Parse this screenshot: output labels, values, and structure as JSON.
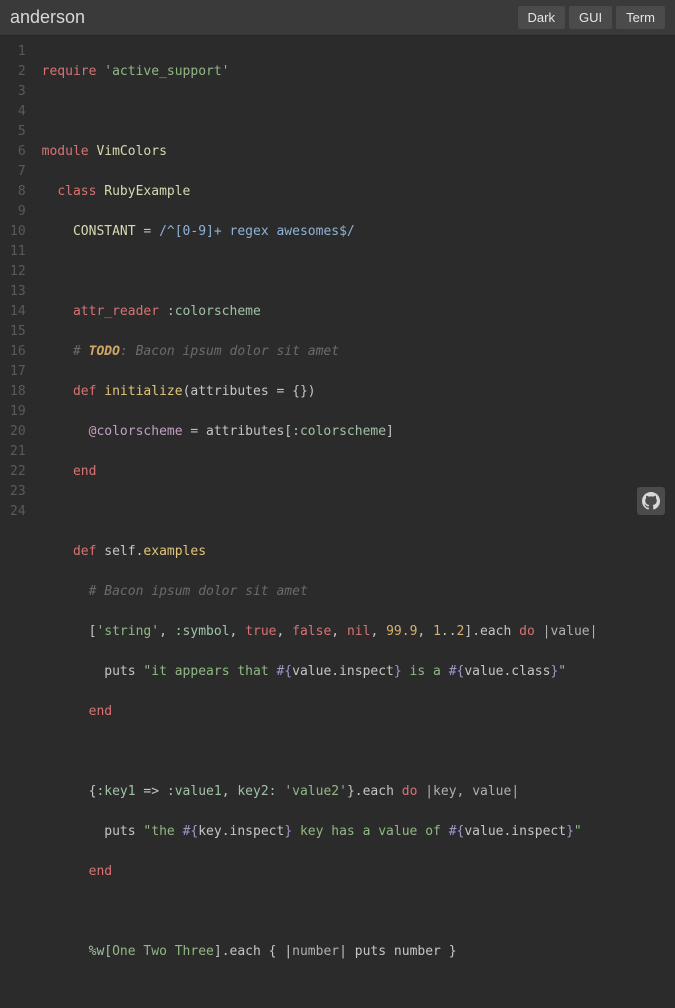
{
  "header": {
    "title": "anderson",
    "buttons": {
      "dark": "Dark",
      "gui": "GUI",
      "term": "Term"
    }
  },
  "code": {
    "l1": {
      "require": "require",
      "str": "'active_support'"
    },
    "l3": {
      "module": "module",
      "name": "VimColors"
    },
    "l4": {
      "class": "class",
      "name": "RubyExample"
    },
    "l5": {
      "const": "CONSTANT",
      "eq": "=",
      "regex": "/^[0-9]+ regex awesomes$/"
    },
    "l7": {
      "attr": "attr_reader",
      "sym": ":colorscheme"
    },
    "l8": {
      "hash": "#",
      "todo": "TODO",
      "rest": ": Bacon ipsum dolor sit amet"
    },
    "l9": {
      "def": "def",
      "name": "initialize",
      "args": "(attributes = {})"
    },
    "l10": {
      "ivar": "@colorscheme",
      "eq": "=",
      "rhs1": "attributes[",
      "sym": ":colorscheme",
      "rhs2": "]"
    },
    "l11": {
      "end": "end"
    },
    "l13": {
      "def": "def",
      "self": "self",
      "dot": ".",
      "name": "examples"
    },
    "l14": {
      "cmt": "# Bacon ipsum dolor sit amet"
    },
    "l15": {
      "lb": "[",
      "str": "'string'",
      "c1": ", ",
      "sym": ":symbol",
      "c2": ", ",
      "true": "true",
      "c3": ", ",
      "false": "false",
      "c4": ", ",
      "nil": "nil",
      "c5": ", ",
      "n1": "99.9",
      "c6": ", ",
      "r1": "1",
      "dd": "..",
      "r2": "2",
      "rb": "].each ",
      "do": "do",
      "blk": " |value|"
    },
    "l16": {
      "puts": "puts ",
      "q1": "\"it appears that ",
      "io": "#{",
      "v1": "value.inspect",
      "ic": "}",
      "mid": " is a ",
      "io2": "#{",
      "v2": "value.class",
      "ic2": "}",
      "q2": "\""
    },
    "l17": {
      "end": "end"
    },
    "l19": {
      "lb": "{",
      "sym1": ":key1",
      "ar": " => ",
      "sym2": ":value1",
      "c1": ", ",
      "k2": "key2:",
      "sp": " ",
      "str2": "'value2'",
      "rb": "}.each ",
      "do": "do",
      "blk": " |key, value|"
    },
    "l20": {
      "puts": "puts ",
      "q1": "\"the ",
      "io": "#{",
      "v1": "key.inspect",
      "ic": "}",
      "mid": " key has a value of ",
      "io2": "#{",
      "v2": "value.inspect",
      "ic2": "}",
      "q2": "\""
    },
    "l21": {
      "end": "end"
    },
    "l23": {
      "pw": "%w[",
      "w1": "One",
      "s1": " ",
      "w2": "Two",
      "s2": " ",
      "w3": "Three",
      "rb": "].each { |",
      "bv": "number",
      "rb2": "| puts number }"
    }
  },
  "chart_data": {
    "type": "table",
    "title": "Ruby code sample (anderson colorscheme)",
    "lines": [
      "require 'active_support'",
      "",
      "module VimColors",
      "  class RubyExample",
      "    CONSTANT = /^[0-9]+ regex awesomes$/",
      "",
      "    attr_reader :colorscheme",
      "    # TODO: Bacon ipsum dolor sit amet",
      "    def initialize(attributes = {})",
      "      @colorscheme = attributes[:colorscheme]",
      "    end",
      "",
      "    def self.examples",
      "      # Bacon ipsum dolor sit amet",
      "      ['string', :symbol, true, false, nil, 99.9, 1..2].each do |value|",
      "        puts \"it appears that #{value.inspect} is a #{value.class}\"",
      "      end",
      "",
      "      {:key1 => :value1, key2: 'value2'}.each do |key, value|",
      "        puts \"the #{key.inspect} key has a value of #{value.inspect}\"",
      "      end",
      "",
      "      %w[One Two Three].each { |number| puts number }"
    ]
  }
}
